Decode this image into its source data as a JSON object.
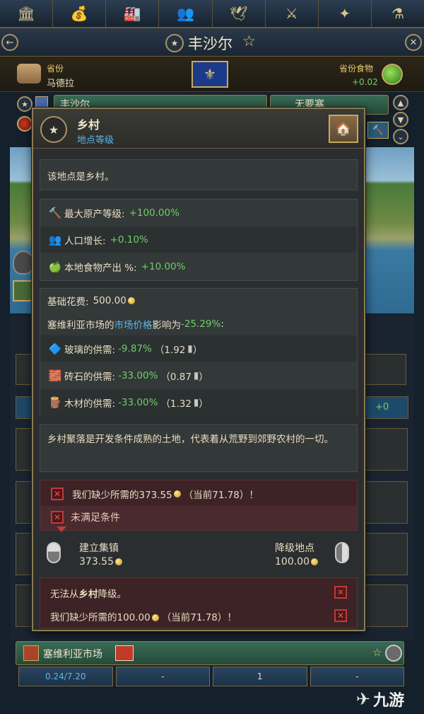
{
  "nav": [
    "🏛",
    "💰",
    "🏭",
    "👥",
    "🕊",
    "⚔",
    "✦",
    "⚗"
  ],
  "header": {
    "title": "丰沙尔",
    "star": "☆",
    "back": "←",
    "close": "✕"
  },
  "province": {
    "label": "省份",
    "name": "马德拉",
    "food_label": "省份食物",
    "food_value": "+0.02"
  },
  "location_row": {
    "location_name": "丰沙尔",
    "fortress_label": "无要塞"
  },
  "tooltip": {
    "title": "乡村",
    "subtitle": "地点等级",
    "desc": "该地点是乡村。",
    "modifiers": [
      {
        "icon": "🔨",
        "label": "最大原产等级:",
        "value": "+100.00%"
      },
      {
        "icon": "👥",
        "label": "人口增长:",
        "value": "+0.10%"
      },
      {
        "icon": "🍏",
        "label": "本地食物产出 %:",
        "value": "+10.00%"
      }
    ],
    "base_cost_label": "基础花费:",
    "base_cost_value": "500.00",
    "market_line": {
      "market": "塞维利亚市场",
      "de": "的",
      "price": "市场价格",
      "effect": "影响为",
      "value": "-25.29%",
      "colon": ":"
    },
    "supplies": [
      {
        "icon": "🔷",
        "label": "玻璃的供需:",
        "value": "-9.87%",
        "extra": "（1.92"
      },
      {
        "icon": "🧱",
        "label": "砖石的供需:",
        "value": "-33.00%",
        "extra": "（0.87"
      },
      {
        "icon": "🪵",
        "label": "木材的供需:",
        "value": "-33.00%",
        "extra": "（1.32"
      }
    ],
    "close_paren": "）",
    "flavor": "乡村聚落是开发条件成熟的土地，代表着从荒野到郊野农村的一切。",
    "missing_1_pre": "我们缺少所需的373.55",
    "missing_1_post": "（当前71.78）！",
    "unmet": "未满足条件",
    "build_label": "建立集镇",
    "build_cost": "373.55",
    "downgrade_label": "降级地点",
    "downgrade_cost": "100.00",
    "cannot_pre": "无法从",
    "cannot_bold": "乡村",
    "cannot_post": "降级。",
    "missing_2_pre": "我们缺少所需的100.00",
    "missing_2_post": "（当前71.78）！"
  },
  "side_value": "+0",
  "market": {
    "name": "塞维利亚市场",
    "cells": [
      "0.24/7.20",
      "-",
      "1",
      "-"
    ]
  },
  "watermark": "九游",
  "colors": {
    "positive": "#6fcf6a",
    "link": "#5cb6e8",
    "negative_border": "#c23a3a"
  }
}
